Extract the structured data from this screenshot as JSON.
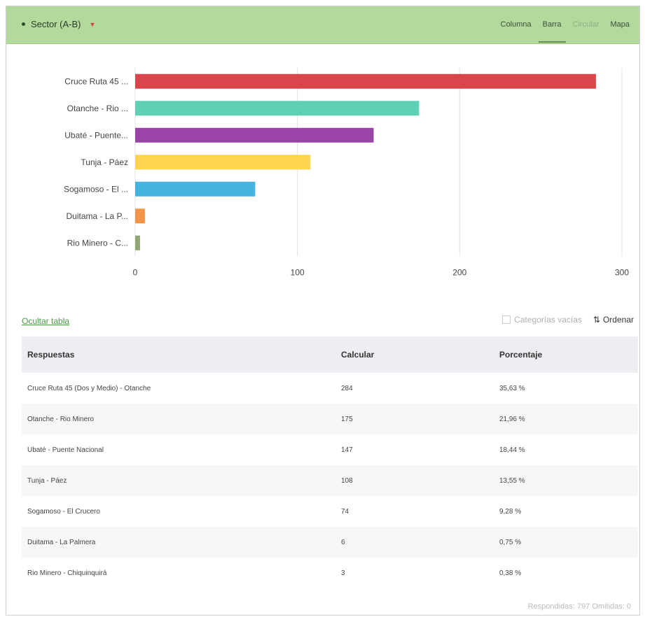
{
  "question": {
    "title": "Sector (A-B)"
  },
  "tabs": [
    {
      "label": "Columna",
      "state": "normal"
    },
    {
      "label": "Barra",
      "state": "active"
    },
    {
      "label": "Circular",
      "state": "disabled"
    },
    {
      "label": "Mapa",
      "state": "normal"
    }
  ],
  "chart_data": {
    "type": "bar",
    "orientation": "horizontal",
    "categories": [
      "Cruce Ruta 45 ...",
      "Otanche - Rio ...",
      "Ubaté - Puente...",
      "Tunja - Páez",
      "Sogamoso - El ...",
      "Duitama - La P...",
      "Rio Minero - C..."
    ],
    "values": [
      284,
      175,
      147,
      108,
      74,
      6,
      3
    ],
    "colors": [
      "#d9454b",
      "#5fd0b4",
      "#9b44a8",
      "#ffd54f",
      "#45b3e0",
      "#f29548",
      "#8ea873"
    ],
    "xlim": [
      0,
      300
    ],
    "xticks": [
      "0",
      "100",
      "200",
      "300"
    ],
    "grid": true
  },
  "controls": {
    "hide_table": "Ocultar tabla",
    "empty_categories": "Categorías vacías",
    "sort": "Ordenar"
  },
  "table": {
    "headers": [
      "Respuestas",
      "Calcular",
      "Porcentaje"
    ],
    "rows": [
      [
        "Cruce Ruta 45 (Dos y Medio) - Otanche",
        "284",
        "35,63 %"
      ],
      [
        "Otanche - Rio Minero",
        "175",
        "21,96 %"
      ],
      [
        "Ubaté - Puente Nacional",
        "147",
        "18,44 %"
      ],
      [
        "Tunja - Páez",
        "108",
        "13,55 %"
      ],
      [
        "Sogamoso - El Crucero",
        "74",
        "9,28 %"
      ],
      [
        "Duitama - La Palmera",
        "6",
        "0,75 %"
      ],
      [
        "Rio Minero - Chiquinquirá",
        "3",
        "0,38 %"
      ]
    ]
  },
  "footer": "Respondidas: 797  Omitidas: 0"
}
